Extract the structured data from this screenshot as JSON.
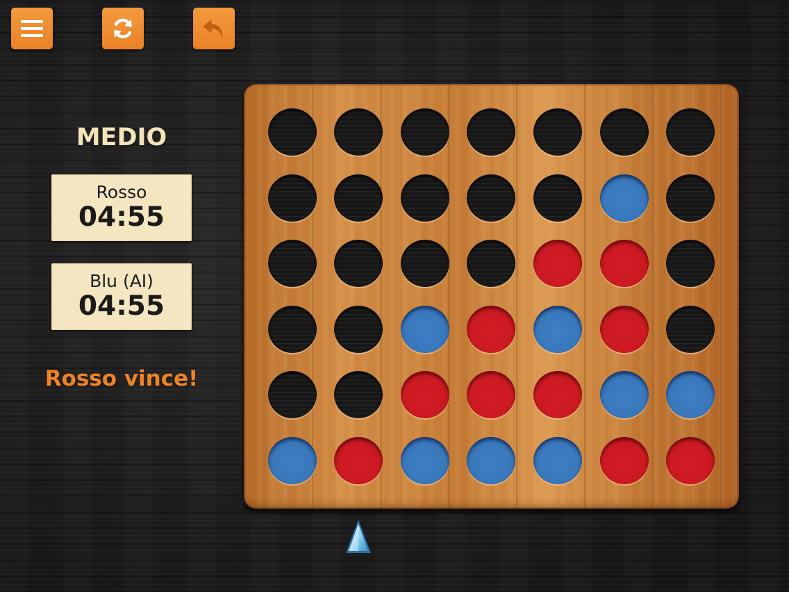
{
  "toolbar": {
    "menu_icon": "hamburger-menu-icon",
    "restart_icon": "refresh-icon",
    "undo_icon": "undo-arrow-icon",
    "accent_color": "#ee8327"
  },
  "panel": {
    "difficulty": "MEDIO",
    "players": [
      {
        "name": "Rosso",
        "time": "04:55",
        "color": "#d31d25"
      },
      {
        "name": "Blu (AI)",
        "time": "04:55",
        "color": "#3a78bc"
      }
    ],
    "status": "Rosso vince!"
  },
  "board": {
    "columns": 7,
    "rows": 6,
    "cells": [
      [
        "empty",
        "empty",
        "empty",
        "empty",
        "empty",
        "empty",
        "empty"
      ],
      [
        "empty",
        "empty",
        "empty",
        "empty",
        "empty",
        "blue",
        "empty"
      ],
      [
        "empty",
        "empty",
        "empty",
        "empty",
        "red",
        "red",
        "empty"
      ],
      [
        "empty",
        "empty",
        "blue",
        "red",
        "blue",
        "red",
        "empty"
      ],
      [
        "empty",
        "empty",
        "red",
        "red",
        "red",
        "blue",
        "blue"
      ],
      [
        "blue",
        "red",
        "blue",
        "blue",
        "blue",
        "red",
        "red"
      ]
    ],
    "selected_column": 1,
    "marker_icon": "triangle-pointer-icon"
  }
}
